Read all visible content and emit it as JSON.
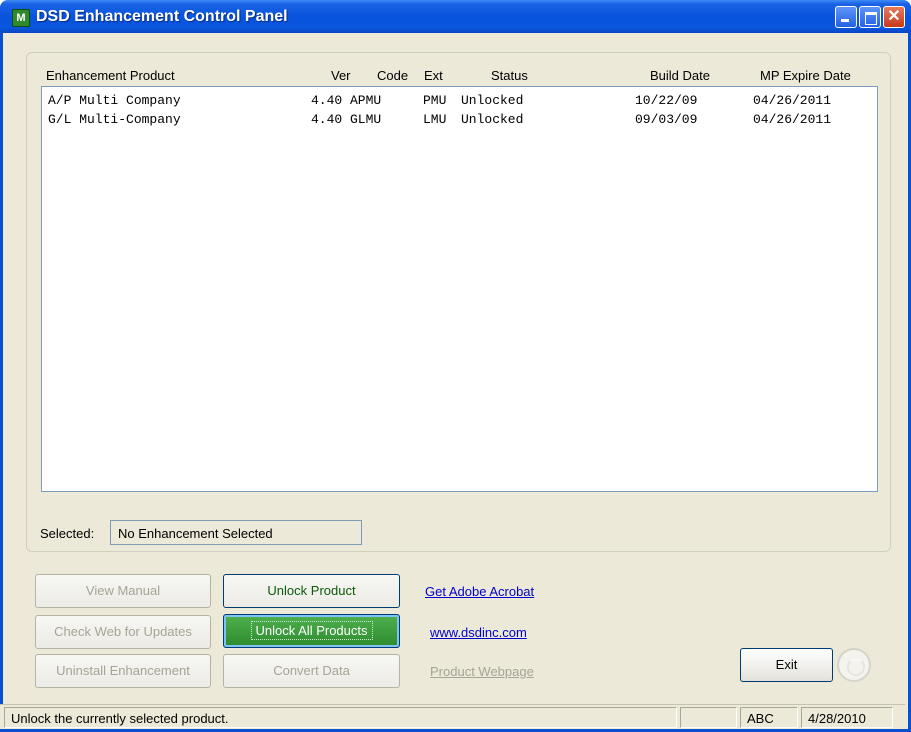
{
  "window": {
    "title": "DSD Enhancement Control Panel",
    "icon_text": "M"
  },
  "columns": {
    "product": "Enhancement Product",
    "ver": "Ver",
    "code": "Code",
    "ext": "Ext",
    "status": "Status",
    "build_date": "Build Date",
    "mp_expire": "MP Expire Date"
  },
  "rows": [
    {
      "product": "A/P Multi Company",
      "ver": "4.40",
      "code": "APMU",
      "ext": "PMU",
      "status": "Unlocked",
      "build_date": "10/22/09",
      "mp_expire": "04/26/2011"
    },
    {
      "product": "G/L Multi-Company",
      "ver": "4.40",
      "code": "GLMU",
      "ext": "LMU",
      "status": "Unlocked",
      "build_date": "09/03/09",
      "mp_expire": "04/26/2011"
    }
  ],
  "selected": {
    "label": "Selected:",
    "value": "No Enhancement Selected"
  },
  "buttons": {
    "view_manual": "View Manual",
    "check_web": "Check Web for Updates",
    "uninstall": "Uninstall Enhancement",
    "unlock_product": "Unlock Product",
    "unlock_all": "Unlock All Products",
    "convert_data": "Convert Data",
    "exit": "Exit"
  },
  "links": {
    "adobe": "Get Adobe Acrobat",
    "dsdinc": "www.dsdinc.com",
    "product_webpage": "Product Webpage"
  },
  "statusbar": {
    "message": "Unlock the currently selected product.",
    "empty": "",
    "caps": "ABC",
    "date": "4/28/2010"
  },
  "colors": {
    "titlebar": "#0854dc",
    "default_button": "#2d8a2d",
    "link": "#0000cc"
  }
}
